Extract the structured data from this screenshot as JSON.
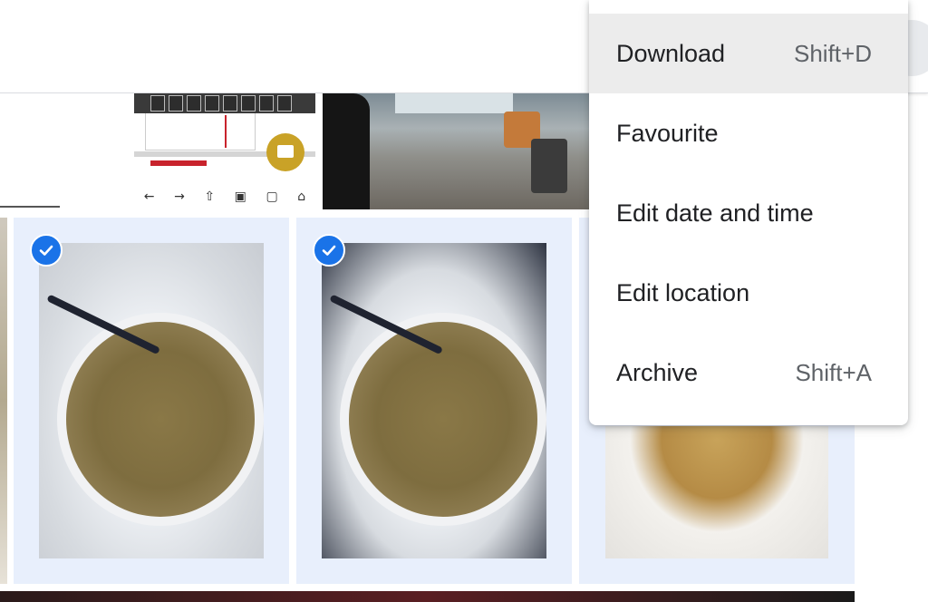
{
  "context_menu": {
    "items": [
      {
        "label": "Download",
        "shortcut": "Shift+D",
        "highlighted": true
      },
      {
        "label": "Favourite",
        "shortcut": ""
      },
      {
        "label": "Edit date and time",
        "shortcut": ""
      },
      {
        "label": "Edit location",
        "shortcut": ""
      },
      {
        "label": "Archive",
        "shortcut": "Shift+A"
      }
    ]
  },
  "grid": {
    "selected_count_shown": 2,
    "selection_color": "#1a73e8",
    "selected_background": "#e8effc"
  },
  "colors": {
    "menu_highlight": "#ececec",
    "text_primary": "#202124",
    "text_secondary": "#5f6368"
  }
}
